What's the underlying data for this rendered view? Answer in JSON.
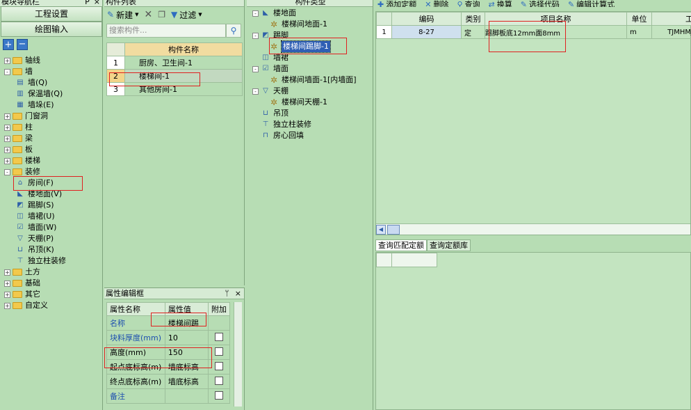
{
  "left": {
    "title": "模块导航栏",
    "pin": "P",
    "close": "×",
    "btn_project": "工程设置",
    "btn_draw": "绘图输入",
    "tree": [
      {
        "label": "轴线",
        "level": 0,
        "exp": "+",
        "icon": "folder"
      },
      {
        "label": "墙",
        "level": 0,
        "exp": "-",
        "icon": "folder"
      },
      {
        "label": "墙(Q)",
        "level": 1,
        "icon": "wall-icon"
      },
      {
        "label": "保温墙(Q)",
        "level": 1,
        "icon": "insulation-wall-icon"
      },
      {
        "label": "墙垛(E)",
        "level": 1,
        "icon": "wall-pier-icon"
      },
      {
        "label": "门窗洞",
        "level": 0,
        "exp": "+",
        "icon": "folder"
      },
      {
        "label": "柱",
        "level": 0,
        "exp": "+",
        "icon": "folder"
      },
      {
        "label": "梁",
        "level": 0,
        "exp": "+",
        "icon": "folder"
      },
      {
        "label": "板",
        "level": 0,
        "exp": "+",
        "icon": "folder"
      },
      {
        "label": "楼梯",
        "level": 0,
        "exp": "+",
        "icon": "folder"
      },
      {
        "label": "装修",
        "level": 0,
        "exp": "-",
        "icon": "folder"
      },
      {
        "label": "房间(F)",
        "level": 1,
        "icon": "room-icon"
      },
      {
        "label": "楼地面(V)",
        "level": 1,
        "icon": "floor-icon"
      },
      {
        "label": "踢脚(S)",
        "level": 1,
        "icon": "skirting-icon"
      },
      {
        "label": "墙裙(U)",
        "level": 1,
        "icon": "dado-icon"
      },
      {
        "label": "墙面(W)",
        "level": 1,
        "icon": "wall-surface-icon"
      },
      {
        "label": "天棚(P)",
        "level": 1,
        "icon": "ceiling-icon"
      },
      {
        "label": "吊顶(K)",
        "level": 1,
        "icon": "suspended-ceiling-icon"
      },
      {
        "label": "独立柱装修",
        "level": 1,
        "icon": "column-finish-icon"
      },
      {
        "label": "土方",
        "level": 0,
        "exp": "+",
        "icon": "folder"
      },
      {
        "label": "基础",
        "level": 0,
        "exp": "+",
        "icon": "folder"
      },
      {
        "label": "其它",
        "level": 0,
        "exp": "+",
        "icon": "folder"
      },
      {
        "label": "自定义",
        "level": 0,
        "exp": "+",
        "icon": "folder"
      }
    ]
  },
  "components": {
    "title": "构件列表",
    "new_label": "新建",
    "filter_label": "过滤",
    "search_placeholder": "搜索构件...",
    "col_name": "构件名称",
    "rows": [
      {
        "num": "1",
        "name": "厨房、卫生间-1"
      },
      {
        "num": "2",
        "name": "楼梯间-1"
      },
      {
        "num": "3",
        "name": "其他房间-1"
      }
    ]
  },
  "props": {
    "title": "属性编辑框",
    "col_name": "属性名称",
    "col_value": "属性值",
    "col_extra": "附加",
    "rows": [
      {
        "name": "名称",
        "value": "楼梯间踢",
        "blue": true,
        "check": false
      },
      {
        "name": "块料厚度(mm)",
        "value": "10",
        "blue": true,
        "check": true
      },
      {
        "name": "高度(mm)",
        "value": "150",
        "blue": false,
        "check": true
      },
      {
        "name": "起点底标高(m)",
        "value": "墙底标高",
        "blue": false,
        "check": true
      },
      {
        "name": "终点底标高(m)",
        "value": "墙底标高",
        "blue": false,
        "check": true
      },
      {
        "name": "备注",
        "value": "",
        "blue": true,
        "check": true
      }
    ]
  },
  "types": {
    "title": "构件类型",
    "tree": [
      {
        "label": "楼地面",
        "level": 0,
        "exp": "-",
        "icon": "floor-icon"
      },
      {
        "label": "楼梯间地面-1",
        "level": 1,
        "icon": "gear-icon"
      },
      {
        "label": "踢脚",
        "level": 0,
        "exp": "-",
        "icon": "skirting-icon"
      },
      {
        "label": "楼梯间踢脚-1",
        "level": 1,
        "icon": "gear-icon",
        "selected": true
      },
      {
        "label": "墙裙",
        "level": 0,
        "icon": "dado-icon"
      },
      {
        "label": "墙面",
        "level": 0,
        "exp": "-",
        "icon": "wall-surface-icon"
      },
      {
        "label": "楼梯间墙面-1[内墙面]",
        "level": 1,
        "icon": "gear-icon"
      },
      {
        "label": "天棚",
        "level": 0,
        "exp": "-",
        "icon": "ceiling-icon"
      },
      {
        "label": "楼梯间天棚-1",
        "level": 1,
        "icon": "gear-icon"
      },
      {
        "label": "吊顶",
        "level": 0,
        "icon": "suspended-ceiling-icon"
      },
      {
        "label": "独立柱装修",
        "level": 0,
        "icon": "column-finish-icon"
      },
      {
        "label": "房心回填",
        "level": 0,
        "icon": "backfill-icon"
      }
    ]
  },
  "quota": {
    "toolbar": [
      "添加定额",
      "删除",
      "查询",
      "换算",
      "选择代码",
      "编辑计算式"
    ],
    "cols": [
      "编码",
      "类别",
      "项目名称",
      "单位",
      "工"
    ],
    "rows": [
      {
        "num": "1",
        "code": "8-27",
        "type": "定",
        "name": "踢脚板底12mm面8mm",
        "unit": "m",
        "expr": "TJMHMJ"
      }
    ],
    "tab_match": "查询匹配定额",
    "tab_lib": "查询定额库"
  }
}
